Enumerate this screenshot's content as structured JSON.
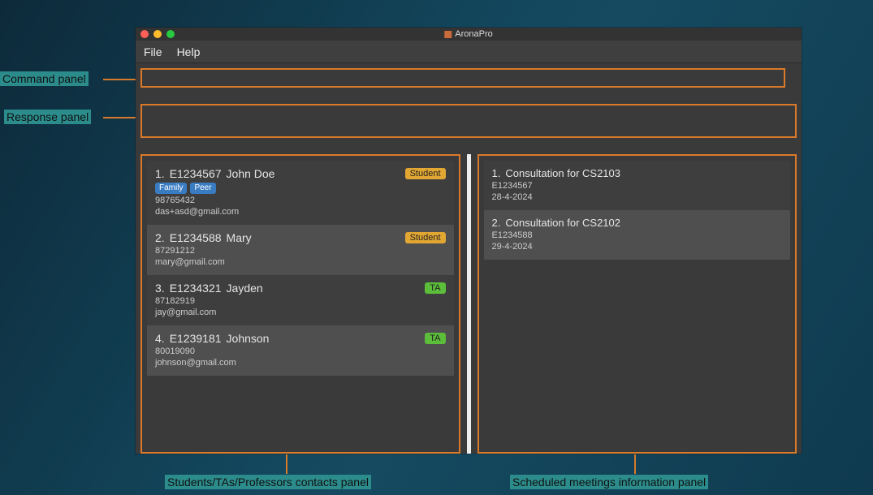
{
  "annotations": {
    "command": "Command panel",
    "response": "Response panel",
    "contacts": "Students/TAs/Professors contacts panel",
    "meetings": "Scheduled meetings information panel"
  },
  "window": {
    "title": "AronaPro"
  },
  "menubar": {
    "file": "File",
    "help": "Help"
  },
  "contacts": [
    {
      "index": "1.",
      "id": "E1234567",
      "name": "John Doe",
      "role": "Student",
      "roleClass": "badge-student",
      "tags": [
        "Family",
        "Peer"
      ],
      "phone": "98765432",
      "email": "das+asd@gmail.com",
      "shade": "row-dark"
    },
    {
      "index": "2.",
      "id": "E1234588",
      "name": "Mary",
      "role": "Student",
      "roleClass": "badge-student",
      "tags": [],
      "phone": "87291212",
      "email": "mary@gmail.com",
      "shade": "row-light"
    },
    {
      "index": "3.",
      "id": "E1234321",
      "name": "Jayden",
      "role": "TA",
      "roleClass": "badge-ta",
      "tags": [],
      "phone": "87182919",
      "email": "jay@gmail.com",
      "shade": "row-dark"
    },
    {
      "index": "4.",
      "id": "E1239181",
      "name": "Johnson",
      "role": "TA",
      "roleClass": "badge-ta",
      "tags": [],
      "phone": "80019090",
      "email": "johnson@gmail.com",
      "shade": "row-light"
    }
  ],
  "meetings": [
    {
      "index": "1.",
      "title": "Consultation for CS2103",
      "id": "E1234567",
      "date": "28-4-2024",
      "shade": "row-dark"
    },
    {
      "index": "2.",
      "title": "Consultation for CS2102",
      "id": "E1234588",
      "date": "29-4-2024",
      "shade": "row-light"
    }
  ]
}
